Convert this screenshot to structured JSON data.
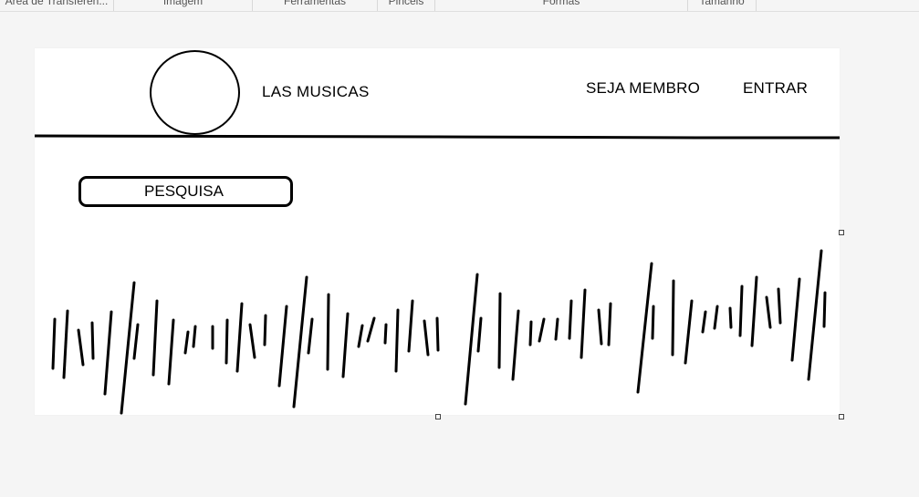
{
  "ribbon": {
    "groups": [
      "Área de Transferên...",
      "Imagem",
      "Ferramentas",
      "Pincéis",
      "Formas",
      "Tamanho"
    ]
  },
  "mockup": {
    "header": {
      "title": "LAS MUSICAS",
      "nav": {
        "signup_label": "SEJA MEMBRO",
        "login_label": "ENTRAR"
      }
    },
    "search": {
      "label": "PESQUISA"
    },
    "waveform_icon": "audio-waveform"
  }
}
